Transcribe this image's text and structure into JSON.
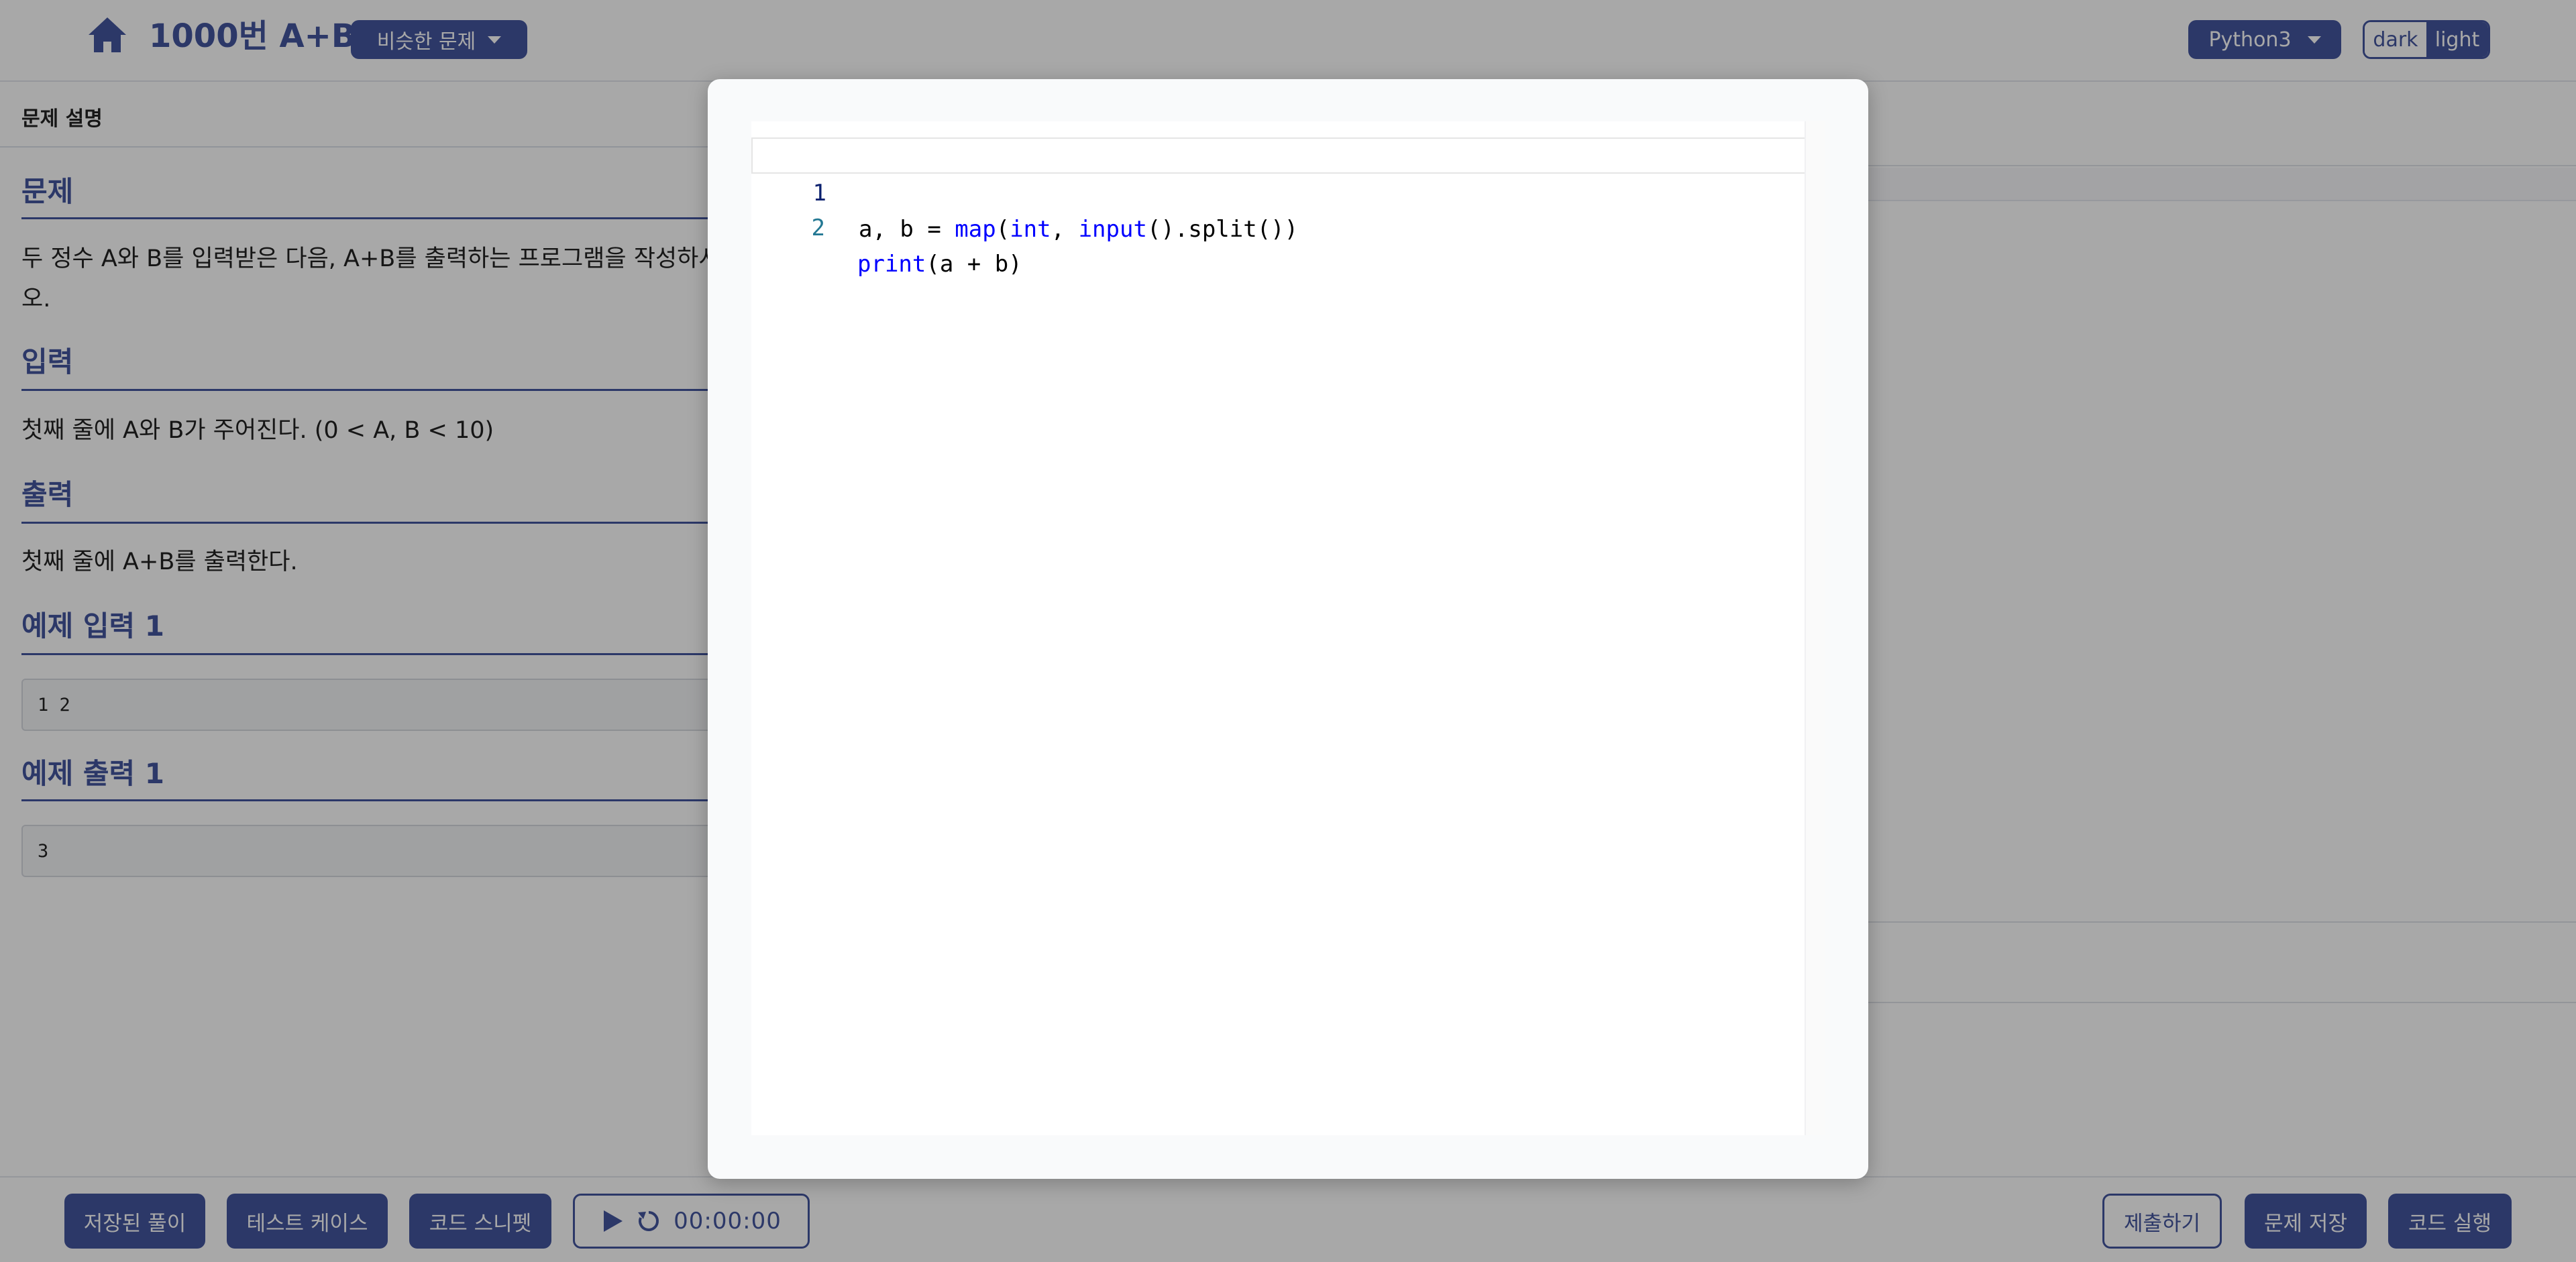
{
  "header": {
    "title": "1000번 A+B",
    "similar_button": "비슷한 문제",
    "language": "Python3",
    "theme_dark": "dark",
    "theme_light": "light"
  },
  "problem": {
    "tab_label": "문제 설명",
    "sections": {
      "problem_title": "문제",
      "problem_text": "두 정수 A와 B를 입력받은 다음, A+B를 출력하는 프로그램을 작성하시오.",
      "input_title": "입력",
      "input_text": "첫째 줄에 A와 B가 주어진다. (0 < A, B < 10)",
      "output_title": "출력",
      "output_text": "첫째 줄에 A+B를 출력한다.",
      "sample_input_title": "예제 입력 1",
      "sample_input": "1 2",
      "sample_output_title": "예제 출력 1",
      "sample_output": "3"
    }
  },
  "footer": {
    "saved_solutions": "저장된 풀이",
    "test_cases": "테스트 케이스",
    "code_snippets": "코드 스니펫",
    "timer": "00:00:00",
    "submit": "제출하기",
    "save_problem": "문제 저장",
    "run_code": "코드 실행"
  },
  "modal": {
    "code_lines": [
      {
        "number": "1",
        "tokens": [
          {
            "text": "a, b = ",
            "kind": "plain"
          },
          {
            "text": "map",
            "kind": "builtin"
          },
          {
            "text": "(",
            "kind": "plain"
          },
          {
            "text": "int",
            "kind": "builtin"
          },
          {
            "text": ", ",
            "kind": "plain"
          },
          {
            "text": "input",
            "kind": "builtin"
          },
          {
            "text": "().split())",
            "kind": "plain"
          }
        ]
      },
      {
        "number": "2",
        "tokens": [
          {
            "text": "print",
            "kind": "builtin"
          },
          {
            "text": "(a + b)",
            "kind": "plain"
          }
        ]
      }
    ]
  },
  "colors": {
    "accent": "#44559f",
    "builtin_token": "#0000ff",
    "line_number": "#237893"
  },
  "icons": [
    "home-icon",
    "caret-down-icon",
    "play-icon",
    "reset-icon"
  ]
}
